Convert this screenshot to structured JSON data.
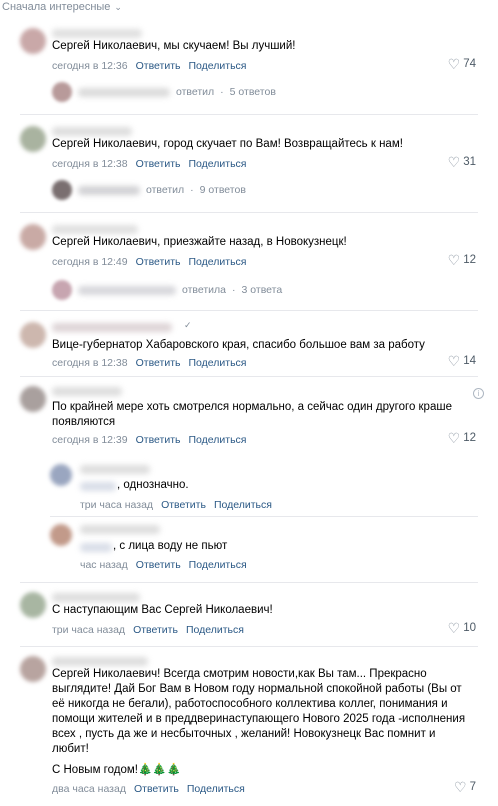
{
  "sort_label": "Сначала интересные",
  "comments": [
    {
      "text": "Сергей Николаевич, мы скучаем! Вы лучший!",
      "time": "сегодня в 12:36",
      "reply": "Ответить",
      "share": "Поделиться",
      "likes": "74",
      "thread": {
        "verb": "ответил",
        "count": "5 ответов"
      }
    },
    {
      "text": "Сергей Николаевич, город скучает по Вам! Возвращайтесь к нам!",
      "time": "сегодня в 12:38",
      "reply": "Ответить",
      "share": "Поделиться",
      "likes": "31",
      "thread": {
        "verb": "ответил",
        "count": "9 ответов"
      }
    },
    {
      "text": "Сергей Николаевич, приезжайте назад, в Новокузнецк!",
      "time": "сегодня в 12:49",
      "reply": "Ответить",
      "share": "Поделиться",
      "likes": "12",
      "thread": {
        "verb": "ответила",
        "count": "3 ответа"
      }
    },
    {
      "text": "Вице-губернатор Хабаровского края, спасибо большое вам за работу",
      "time": "сегодня в 12:38",
      "reply": "Ответить",
      "share": "Поделиться",
      "likes": "14"
    },
    {
      "text": "По крайней мере хоть смотрелся нормально, а сейчас один другого краше появляются",
      "time": "сегодня в 12:39",
      "reply": "Ответить",
      "share": "Поделиться",
      "likes": "12"
    },
    {
      "text": "С наступающим Вас Сергей Николаевич!",
      "time": "три часа назад",
      "reply": "Ответить",
      "share": "Поделиться",
      "likes": "10"
    },
    {
      "text": "Сергей Николаевич! Всегда смотрим новости,как Вы там... Прекрасно выглядите! Дай Бог Вам в Новом году нормальной спокойной работы (Вы от её никогда не бегали), работоспособного коллектива коллег, понимания и помощи жителей и в преддверинаступающего Нового 2025 года -исполнения всех , пусть да же и несбыточных , желаний! Новокузнецк Вас помнит и любит!",
      "extra": "С Новым годом!🎄🎄🎄",
      "time": "два часа назад",
      "reply": "Ответить",
      "share": "Поделиться",
      "likes": "7"
    }
  ],
  "replies": [
    {
      "text": ", однозначно.",
      "time": "три часа назад",
      "reply": "Ответить",
      "share": "Поделиться"
    },
    {
      "text": ", с лица воду не пьют",
      "time": "час назад",
      "reply": "Ответить",
      "share": "Поделиться"
    }
  ]
}
